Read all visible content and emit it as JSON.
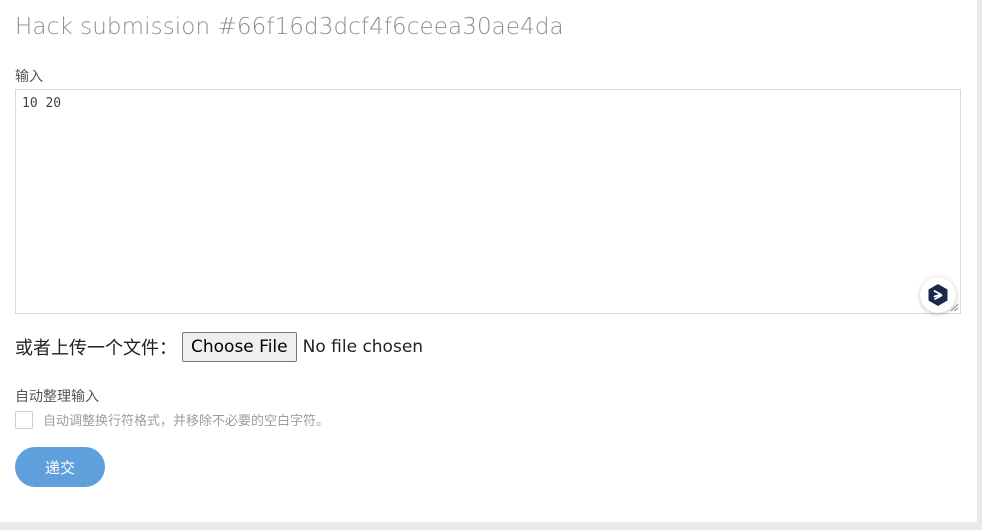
{
  "page": {
    "title": "Hack submission #66f16d3dcf4f6ceea30ae4da"
  },
  "input_section": {
    "label": "输入",
    "value": "10 20"
  },
  "extension": {
    "icon": "deepseek-icon",
    "color": "#1b2a4a"
  },
  "upload": {
    "label": "或者上传一个文件：",
    "button_label": "Choose File",
    "status": "No file chosen"
  },
  "auto_format": {
    "label": "自动整理输入",
    "checkbox_label": "自动调整换行符格式，并移除不必要的空白字符。",
    "checked": false
  },
  "submit": {
    "label": "递交",
    "color": "#5fa0dc"
  }
}
